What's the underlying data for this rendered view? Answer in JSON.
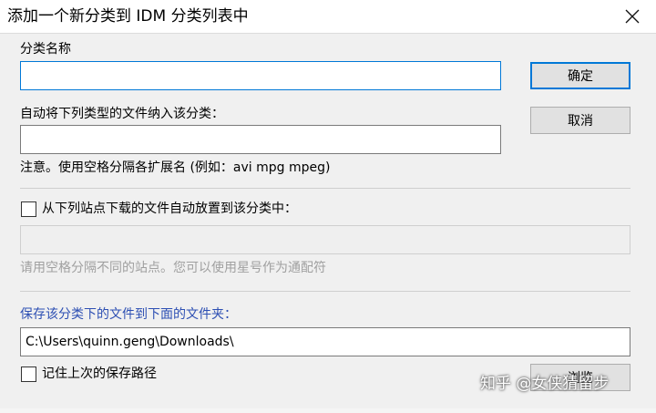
{
  "window": {
    "title": "添加一个新分类到 IDM 分类列表中"
  },
  "icons": {
    "close": "close-icon"
  },
  "form": {
    "category_name_label": "分类名称",
    "category_name_value": "",
    "auto_types_label": "自动将下列类型的文件纳入该分类：",
    "auto_types_value": "",
    "note": "注意。使用空格分隔各扩展名 (例如：avi mpg mpeg)",
    "sites_checkbox_label": "从下列站点下载的文件自动放置到该分类中：",
    "sites_checked": false,
    "sites_value": "",
    "sites_hint": "请用空格分隔不同的站点。您可以使用星号作为通配符",
    "save_folder_label": "保存该分类下的文件到下面的文件夹：",
    "save_folder_value": "C:\\Users\\quinn.geng\\Downloads\\",
    "remember_label": "记住上次的保存路径",
    "remember_checked": false
  },
  "buttons": {
    "ok": "确定",
    "cancel": "取消",
    "browse": "浏览"
  },
  "watermark": "知乎 @女侠猜留步",
  "colors": {
    "accent": "#0078d7",
    "folder_label": "#2d4fb3",
    "hint_text": "#a0a0a0"
  }
}
